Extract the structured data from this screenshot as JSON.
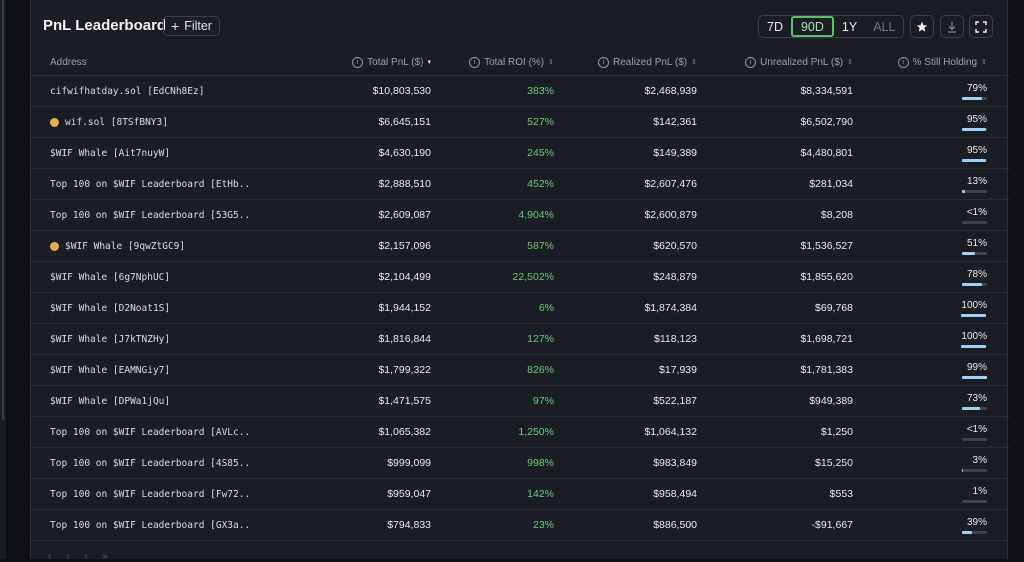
{
  "header": {
    "title": "PnL Leaderboard",
    "filter_label": "Filter",
    "ranges": [
      {
        "label": "7D",
        "state": "normal"
      },
      {
        "label": "90D",
        "state": "active"
      },
      {
        "label": "1Y",
        "state": "normal"
      },
      {
        "label": "ALL",
        "state": "dim"
      }
    ],
    "actions": [
      "star-icon",
      "download-icon",
      "expand-icon"
    ]
  },
  "columns": {
    "address": "Address",
    "total_pnl": "Total PnL ($)",
    "total_roi": "Total ROI (%)",
    "realized": "Realized PnL ($)",
    "unrealized": "Unrealized PnL ($)",
    "holding": "% Still Holding"
  },
  "rows": [
    {
      "address": "cifwifhatday.sol [EdCNh8Ez]",
      "emoji": false,
      "pnl": "$10,803,530",
      "roi": "383%",
      "realized": "$2,468,939",
      "unrealized": "$8,334,591",
      "holding": "79%",
      "holding_value": 0.79
    },
    {
      "address": "wif.sol [8TSfBNY3]",
      "emoji": true,
      "pnl": "$6,645,151",
      "roi": "527%",
      "realized": "$142,361",
      "unrealized": "$6,502,790",
      "holding": "95%",
      "holding_value": 0.95
    },
    {
      "address": "$WIF Whale [Ait7nuyW]",
      "emoji": false,
      "pnl": "$4,630,190",
      "roi": "245%",
      "realized": "$149,389",
      "unrealized": "$4,480,801",
      "holding": "95%",
      "holding_value": 0.95
    },
    {
      "address": "Top 100 on $WIF Leaderboard [EtHb...",
      "emoji": false,
      "pnl": "$2,888,510",
      "roi": "452%",
      "realized": "$2,607,476",
      "unrealized": "$281,034",
      "holding": "13%",
      "holding_value": 0.13
    },
    {
      "address": "Top 100 on $WIF Leaderboard [53G5...",
      "emoji": false,
      "pnl": "$2,609,087",
      "roi": "4,904%",
      "realized": "$2,600,879",
      "unrealized": "$8,208",
      "holding": "<1%",
      "holding_value": 0.0
    },
    {
      "address": "$WIF Whale [9qwZtGC9]",
      "emoji": true,
      "pnl": "$2,157,096",
      "roi": "587%",
      "realized": "$620,570",
      "unrealized": "$1,536,527",
      "holding": "51%",
      "holding_value": 0.51
    },
    {
      "address": "$WIF Whale [6g7NphUC]",
      "emoji": false,
      "pnl": "$2,104,499",
      "roi": "22,502%",
      "realized": "$248,879",
      "unrealized": "$1,855,620",
      "holding": "78%",
      "holding_value": 0.78
    },
    {
      "address": "$WIF Whale [D2Noat1S]",
      "emoji": false,
      "pnl": "$1,944,152",
      "roi": "6%",
      "realized": "$1,874,384",
      "unrealized": "$69,768",
      "holding": "100%",
      "holding_value": 1.0
    },
    {
      "address": "$WIF Whale [J7kTNZHy]",
      "emoji": false,
      "pnl": "$1,816,844",
      "roi": "127%",
      "realized": "$118,123",
      "unrealized": "$1,698,721",
      "holding": "100%",
      "holding_value": 1.0
    },
    {
      "address": "$WIF Whale [EAMNGiy7]",
      "emoji": false,
      "pnl": "$1,799,322",
      "roi": "826%",
      "realized": "$17,939",
      "unrealized": "$1,781,383",
      "holding": "99%",
      "holding_value": 0.99
    },
    {
      "address": "$WIF Whale [DPWa1jQu]",
      "emoji": false,
      "pnl": "$1,471,575",
      "roi": "97%",
      "realized": "$522,187",
      "unrealized": "$949,389",
      "holding": "73%",
      "holding_value": 0.73
    },
    {
      "address": "Top 100 on $WIF Leaderboard [AVLc...",
      "emoji": false,
      "pnl": "$1,065,382",
      "roi": "1,250%",
      "realized": "$1,064,132",
      "unrealized": "$1,250",
      "holding": "<1%",
      "holding_value": 0.0
    },
    {
      "address": "Top 100 on $WIF Leaderboard [4S85...",
      "emoji": false,
      "pnl": "$999,099",
      "roi": "998%",
      "realized": "$983,849",
      "unrealized": "$15,250",
      "holding": "3%",
      "holding_value": 0.03
    },
    {
      "address": "Top 100 on $WIF Leaderboard [Fw72...",
      "emoji": false,
      "pnl": "$959,047",
      "roi": "142%",
      "realized": "$958,494",
      "unrealized": "$553",
      "holding": "1%",
      "holding_value": 0.01
    },
    {
      "address": "Top 100 on $WIF Leaderboard [GX3a...",
      "emoji": false,
      "pnl": "$794,833",
      "roi": "23%",
      "realized": "$886,500",
      "unrealized": "-$91,667",
      "holding": "39%",
      "holding_value": 0.39
    }
  ]
}
